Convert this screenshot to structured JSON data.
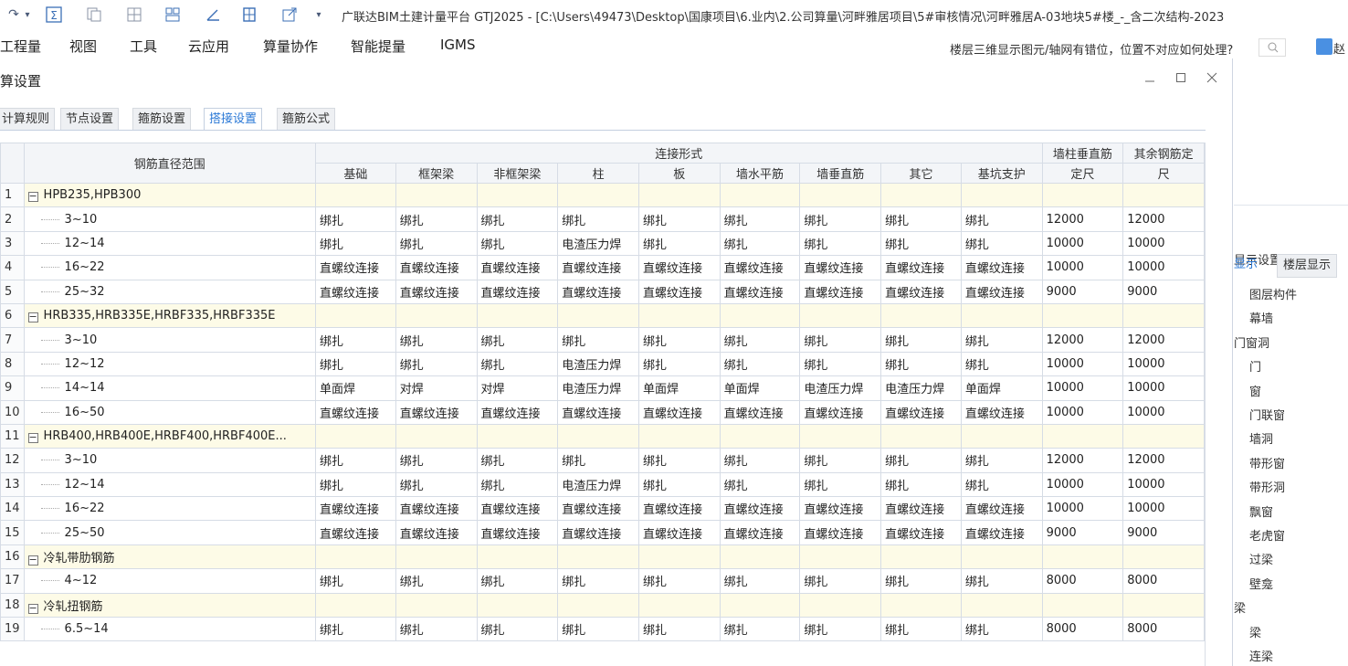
{
  "window": {
    "title": "广联达BIM土建计量平台 GTJ2025 - [C:\\Users\\49473\\Desktop\\国康项目\\6.业内\\2.公司算量\\河畔雅居项目\\5#审核情况\\河畔雅居A-03地块5#楼_-_含二次结构-2023"
  },
  "menu": {
    "items": [
      "工程量",
      "视图",
      "工具",
      "云应用",
      "算量协作",
      "智能提量",
      "IGMS"
    ],
    "help_text": "楼层三维显示图元/轴网有错位，位置不对应如何处理?",
    "user": "赵"
  },
  "dialog": {
    "title": "算设置",
    "tabs": [
      "计算规则",
      "节点设置",
      "箍筋设置",
      "搭接设置",
      "箍筋公式"
    ],
    "active_tab": 3
  },
  "table": {
    "header_diameter": "钢筋直径范围",
    "header_group": "连接形式",
    "columns": [
      "基础",
      "框架梁",
      "非框架梁",
      "柱",
      "板",
      "墙水平筋",
      "墙垂直筋",
      "其它",
      "基坑支护"
    ],
    "header_wall_col": [
      "墙柱垂直筋",
      "定尺"
    ],
    "header_other_len": [
      "其余钢筋定",
      "尺"
    ],
    "rows": [
      {
        "n": "1",
        "group": true,
        "label": "HPB235,HPB300",
        "cells": [
          "",
          "",
          "",
          "",
          "",
          "",
          "",
          "",
          "",
          "",
          ""
        ]
      },
      {
        "n": "2",
        "group": false,
        "label": "3~10",
        "cells": [
          "绑扎",
          "绑扎",
          "绑扎",
          "绑扎",
          "绑扎",
          "绑扎",
          "绑扎",
          "绑扎",
          "绑扎",
          "12000",
          "12000"
        ]
      },
      {
        "n": "3",
        "group": false,
        "label": "12~14",
        "cells": [
          "绑扎",
          "绑扎",
          "绑扎",
          "电渣压力焊",
          "绑扎",
          "绑扎",
          "绑扎",
          "绑扎",
          "绑扎",
          "10000",
          "10000"
        ]
      },
      {
        "n": "4",
        "group": false,
        "label": "16~22",
        "cells": [
          "直螺纹连接",
          "直螺纹连接",
          "直螺纹连接",
          "直螺纹连接",
          "直螺纹连接",
          "直螺纹连接",
          "直螺纹连接",
          "直螺纹连接",
          "直螺纹连接",
          "10000",
          "10000"
        ]
      },
      {
        "n": "5",
        "group": false,
        "label": "25~32",
        "cells": [
          "直螺纹连接",
          "直螺纹连接",
          "直螺纹连接",
          "直螺纹连接",
          "直螺纹连接",
          "直螺纹连接",
          "直螺纹连接",
          "直螺纹连接",
          "直螺纹连接",
          "9000",
          "9000"
        ]
      },
      {
        "n": "6",
        "group": true,
        "label": "HRB335,HRB335E,HRBF335,HRBF335E",
        "cells": [
          "",
          "",
          "",
          "",
          "",
          "",
          "",
          "",
          "",
          "",
          ""
        ]
      },
      {
        "n": "7",
        "group": false,
        "label": "3~10",
        "cells": [
          "绑扎",
          "绑扎",
          "绑扎",
          "绑扎",
          "绑扎",
          "绑扎",
          "绑扎",
          "绑扎",
          "绑扎",
          "12000",
          "12000"
        ]
      },
      {
        "n": "8",
        "group": false,
        "label": "12~12",
        "cells": [
          "绑扎",
          "绑扎",
          "绑扎",
          "电渣压力焊",
          "绑扎",
          "绑扎",
          "绑扎",
          "绑扎",
          "绑扎",
          "10000",
          "10000"
        ]
      },
      {
        "n": "9",
        "group": false,
        "label": "14~14",
        "cells": [
          "单面焊",
          "对焊",
          "对焊",
          "电渣压力焊",
          "单面焊",
          "单面焊",
          "电渣压力焊",
          "电渣压力焊",
          "单面焊",
          "10000",
          "10000"
        ]
      },
      {
        "n": "10",
        "group": false,
        "label": "16~50",
        "cells": [
          "直螺纹连接",
          "直螺纹连接",
          "直螺纹连接",
          "直螺纹连接",
          "直螺纹连接",
          "直螺纹连接",
          "直螺纹连接",
          "直螺纹连接",
          "直螺纹连接",
          "10000",
          "10000"
        ]
      },
      {
        "n": "11",
        "group": true,
        "label": "HRB400,HRB400E,HRBF400,HRBF400E...",
        "cells": [
          "",
          "",
          "",
          "",
          "",
          "",
          "",
          "",
          "",
          "",
          ""
        ]
      },
      {
        "n": "12",
        "group": false,
        "label": "3~10",
        "cells": [
          "绑扎",
          "绑扎",
          "绑扎",
          "绑扎",
          "绑扎",
          "绑扎",
          "绑扎",
          "绑扎",
          "绑扎",
          "12000",
          "12000"
        ]
      },
      {
        "n": "13",
        "group": false,
        "label": "12~14",
        "cells": [
          "绑扎",
          "绑扎",
          "绑扎",
          "电渣压力焊",
          "绑扎",
          "绑扎",
          "绑扎",
          "绑扎",
          "绑扎",
          "10000",
          "10000"
        ]
      },
      {
        "n": "14",
        "group": false,
        "label": "16~22",
        "cells": [
          "直螺纹连接",
          "直螺纹连接",
          "直螺纹连接",
          "直螺纹连接",
          "直螺纹连接",
          "直螺纹连接",
          "直螺纹连接",
          "直螺纹连接",
          "直螺纹连接",
          "10000",
          "10000"
        ]
      },
      {
        "n": "15",
        "group": false,
        "label": "25~50",
        "cells": [
          "直螺纹连接",
          "直螺纹连接",
          "直螺纹连接",
          "直螺纹连接",
          "直螺纹连接",
          "直螺纹连接",
          "直螺纹连接",
          "直螺纹连接",
          "直螺纹连接",
          "9000",
          "9000"
        ]
      },
      {
        "n": "16",
        "group": true,
        "label": "冷轧带肋钢筋",
        "cells": [
          "",
          "",
          "",
          "",
          "",
          "",
          "",
          "",
          "",
          "",
          ""
        ]
      },
      {
        "n": "17",
        "group": false,
        "label": "4~12",
        "cells": [
          "绑扎",
          "绑扎",
          "绑扎",
          "绑扎",
          "绑扎",
          "绑扎",
          "绑扎",
          "绑扎",
          "绑扎",
          "8000",
          "8000"
        ]
      },
      {
        "n": "18",
        "group": true,
        "label": "冷轧扭钢筋",
        "cells": [
          "",
          "",
          "",
          "",
          "",
          "",
          "",
          "",
          "",
          "",
          ""
        ]
      },
      {
        "n": "19",
        "group": false,
        "label": "6.5~14",
        "cells": [
          "绑扎",
          "绑扎",
          "绑扎",
          "绑扎",
          "绑扎",
          "绑扎",
          "绑扎",
          "绑扎",
          "绑扎",
          "8000",
          "8000"
        ]
      }
    ]
  },
  "right_panel": {
    "title": "显示设置",
    "tabs": [
      "显示",
      "楼层显示"
    ],
    "items": [
      "图层构件",
      "幕墙",
      "门窗洞",
      "门",
      "窗",
      "门联窗",
      "墙洞",
      "带形窗",
      "带形洞",
      "飘窗",
      "老虎窗",
      "过梁",
      "壁龛",
      "梁",
      "梁",
      "连梁"
    ],
    "item_levels": [
      1,
      1,
      0,
      1,
      1,
      1,
      1,
      1,
      1,
      1,
      1,
      1,
      1,
      0,
      1,
      1
    ]
  },
  "colors": {
    "group_row_bg": "#fdfbe7",
    "active_tab_text": "#2a78d6",
    "header_bg": "#f3f5f8",
    "grid_line": "#d6dce5"
  }
}
